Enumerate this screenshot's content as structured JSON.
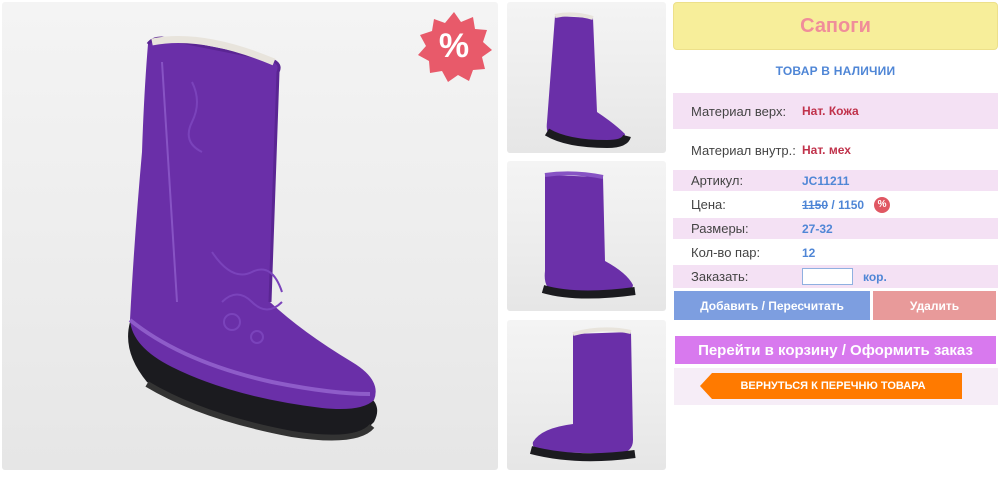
{
  "product": {
    "title": "Сапоги",
    "stock_status": "ТОВАР В НАЛИЧИИ",
    "sale_badge": "%",
    "price_badge": "%"
  },
  "details": [
    {
      "label": "Материал верх:",
      "value": "Нат. Кожа"
    },
    {
      "label": "Материал внутр.:",
      "value": "Нат. мех"
    },
    {
      "label": "Артикул:",
      "value": "JC11211"
    },
    {
      "label": "Цена:",
      "old_price": "1150",
      "separator": " / ",
      "new_price": "1150"
    },
    {
      "label": "Размеры:",
      "value": "27-32"
    },
    {
      "label": "Кол-во пар:",
      "value": "12"
    },
    {
      "label": "Заказать:",
      "input_value": "",
      "unit": "кор."
    }
  ],
  "buttons": {
    "add": "Добавить / Пересчитать",
    "delete": "Удалить",
    "cart": "Перейти в корзину / Оформить заказ",
    "back": "ВЕРНУТЬСЯ К ПЕРЕЧНЮ ТОВАРА"
  },
  "colors": {
    "title_bg": "#f7ee9a",
    "title_text": "#f08d9a",
    "accent_blue": "#4f86d6",
    "value_red": "#c0314a",
    "row_pink": "#f4e1f4",
    "add_button": "#7d9ee0",
    "delete_button": "#e89a9a",
    "cart_button": "#d879ee",
    "back_button": "#ff7a00",
    "boot_purple": "#6a2fa8"
  }
}
